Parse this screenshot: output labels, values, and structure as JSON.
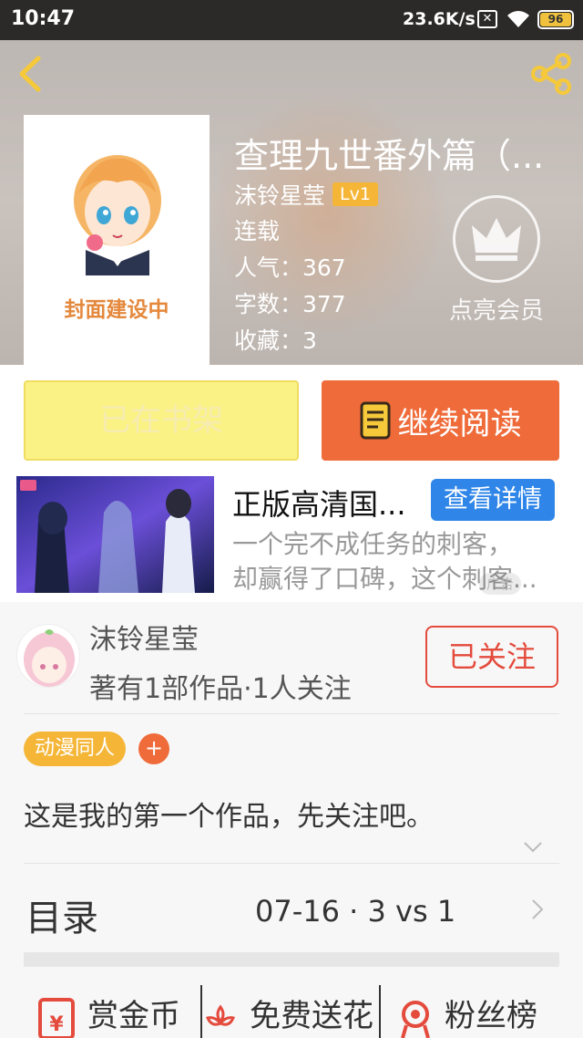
{
  "status_bar": {
    "time": "10:47",
    "speed": "23.6K/s",
    "battery": "96"
  },
  "header": {
    "cover_text": "封面建设中",
    "title": "查理九世番外篇（...",
    "author": "沫铃星莹",
    "level": "Lv1",
    "status": "连载",
    "popularity": "人气：367",
    "word_count": "字数：377",
    "favorites": "收藏：3",
    "vip_label": "点亮会员"
  },
  "buttons": {
    "shelf": "已在书架",
    "read": "继续阅读"
  },
  "ad": {
    "title": "正版高清国...",
    "button": "查看详情",
    "desc_line1": "一个完不成任务的刺客，",
    "desc_line2": "却赢得了口碑，这个刺客...",
    "tag": "广告"
  },
  "author_card": {
    "name": "沫铃星莹",
    "stats": "著有1部作品·1人关注",
    "follow": "已关注",
    "tag": "动漫同人",
    "tag_add": "+",
    "intro": "这是我的第一个作品，先关注吧。"
  },
  "catalog": {
    "title": "目录",
    "latest": "07-16 · 3    vs    1"
  },
  "actions": [
    {
      "label": "赏金币",
      "icon": "red-envelope-icon"
    },
    {
      "label": "免费送花",
      "icon": "flower-icon"
    },
    {
      "label": "粉丝榜",
      "icon": "ranking-medal-icon"
    }
  ],
  "colors": {
    "accent_orange": "#ef6b3a",
    "level_yellow": "#f5b637",
    "shelf_yellow": "#fbf285",
    "follow_red": "#e44b3d",
    "ad_blue": "#2f86e8"
  }
}
